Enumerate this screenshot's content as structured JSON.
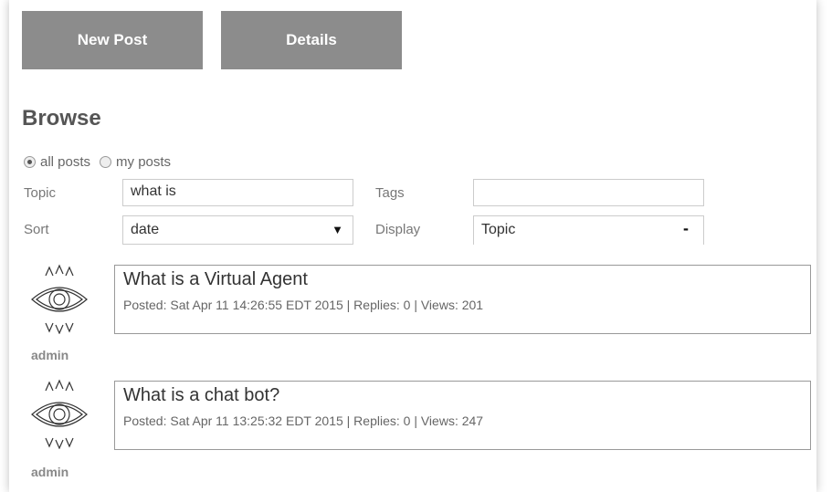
{
  "tabs": {
    "new_post": "New Post",
    "details": "Details"
  },
  "browse": {
    "title": "Browse",
    "filter": {
      "all_posts": "all posts",
      "my_posts": "my posts",
      "selected": "all posts"
    },
    "topic_label": "Topic",
    "topic_value": "what is",
    "tags_label": "Tags",
    "tags_value": "",
    "sort_label": "Sort",
    "sort_value": "date",
    "display_label": "Display",
    "display_value": "Topic"
  },
  "posts": [
    {
      "user": "admin",
      "title": "What is a Virtual Agent",
      "meta": "Posted: Sat Apr 11 14:26:55 EDT 2015 | Replies: 0 | Views: 201"
    },
    {
      "user": "admin",
      "title": "What is a chat bot?",
      "meta": "Posted: Sat Apr 11 13:25:32 EDT 2015 | Replies: 0 | Views: 247"
    }
  ],
  "icons": {
    "avatar": "eye-avatar-icon",
    "dropdown": "chevron-down-icon"
  },
  "colors": {
    "tab_bg": "#8c8c8c",
    "tab_text": "#ffffff"
  }
}
